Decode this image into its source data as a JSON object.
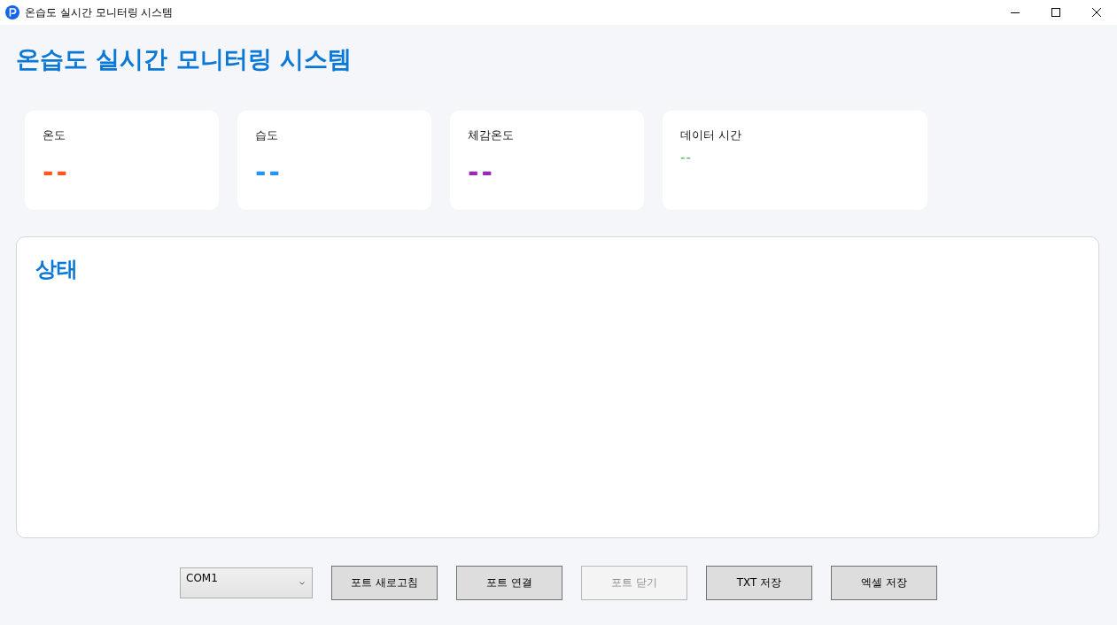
{
  "window": {
    "title": "온습도 실시간 모니터링 시스템"
  },
  "header": {
    "title": "온습도 실시간 모니터링 시스템"
  },
  "cards": [
    {
      "label": "온도",
      "value": "--",
      "color": "#ff5722",
      "kind": "reading"
    },
    {
      "label": "습도",
      "value": "--",
      "color": "#2196f3",
      "kind": "reading"
    },
    {
      "label": "체감온도",
      "value": "--",
      "color": "#9c27b0",
      "kind": "reading"
    },
    {
      "label": "데이터 시간",
      "value": "--",
      "color": "#4caf50",
      "kind": "time"
    }
  ],
  "status_panel": {
    "title": "상태"
  },
  "controls": {
    "port_select": {
      "value": "COM1"
    },
    "buttons": [
      {
        "label": "포트 새로고침",
        "disabled": false
      },
      {
        "label": "포트 연결",
        "disabled": false
      },
      {
        "label": "포트 닫기",
        "disabled": true
      },
      {
        "label": "TXT 저장",
        "disabled": false
      },
      {
        "label": "엑셀 저장",
        "disabled": false
      }
    ]
  }
}
